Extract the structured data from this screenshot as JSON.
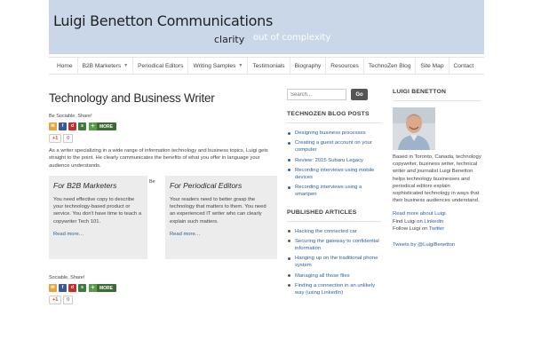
{
  "header": {
    "site_title": "Luigi Benetton Communications",
    "tagline_a": "clarity",
    "tagline_b": "out of complexity"
  },
  "nav": {
    "items": [
      {
        "label": "Home"
      },
      {
        "label": "B2B Marketers",
        "dropdown": true
      },
      {
        "label": "Periodical Editors"
      },
      {
        "label": "Writing Samples",
        "dropdown": true
      },
      {
        "label": "Testimonials"
      },
      {
        "label": "Biography"
      },
      {
        "label": "Resources"
      },
      {
        "label": "TechnoZen Blog"
      },
      {
        "label": "Site Map"
      },
      {
        "label": "Contact"
      }
    ]
  },
  "main": {
    "title": "Technology and Business Writer",
    "share_label": "Be Sociable, Share!",
    "more_label": "MORE",
    "gplus_label": "+1",
    "gplus_count": "0",
    "intro": "As a writer specializing in a wide range of information technology and business topics, Luigi gets straight to the point. He clearly communicates the benefits of what you offer in language your audience understands.",
    "be_label": "Be",
    "box_b2b": {
      "title": "For B2B Marketers",
      "body": "You need effective copy to describe your technology-based product or service. You don't have time to teach a copywriter Tech 101.",
      "read_more": "Read more…"
    },
    "box_periodical": {
      "title": "For Periodical Editors",
      "body": "Your readers need to better grasp the technology that matters to them. You need an experienced IT writer who can clearly explain such matters.",
      "read_more": "Read more…"
    },
    "share2_label": "Sociable, Share!",
    "more2_label": "MORE",
    "gplus2_label": "+1",
    "gplus2_count": "0"
  },
  "sidebar": {
    "search_placeholder": "Search...",
    "go_label": "Go",
    "blog_heading": "TECHNOZEN BLOG POSTS",
    "blog_posts": [
      "Designing business processes",
      "Creating a guest account on your computer",
      "Review: 2015 Subaru Legacy",
      "Recording interviews using mobile devices",
      "Recording interviews using a smartpen"
    ],
    "articles_heading": "PUBLISHED ARTICLES",
    "articles": [
      "Hacking the connected car",
      "Securing the gateway to confidential information",
      "Hanging up on the traditional phone system",
      "Managing all those files",
      "Finding a connection in an unlikely way (using LinkedIn)"
    ]
  },
  "about": {
    "heading": "LUIGI BENETTON",
    "bio": "Based in Toronto, Canada, technology copywriter, business writer, technical writer and journalist Luigi Benetton helps technology businesses and periodical editors explain sophisticated technology in ways that their business audiences understand.",
    "read_more": "Read more about Luigi.",
    "find_prefix": "Find Luigi on ",
    "find_link": "Linkedin",
    "follow_prefix": "Follow Luigi on ",
    "follow_link": "Twitter",
    "tweets": "Tweets by @LuigiBenetton"
  },
  "colors": {
    "header_bg": "#c9d7e9",
    "link": "#2b5e9e",
    "more_green": "#3d6b35"
  }
}
